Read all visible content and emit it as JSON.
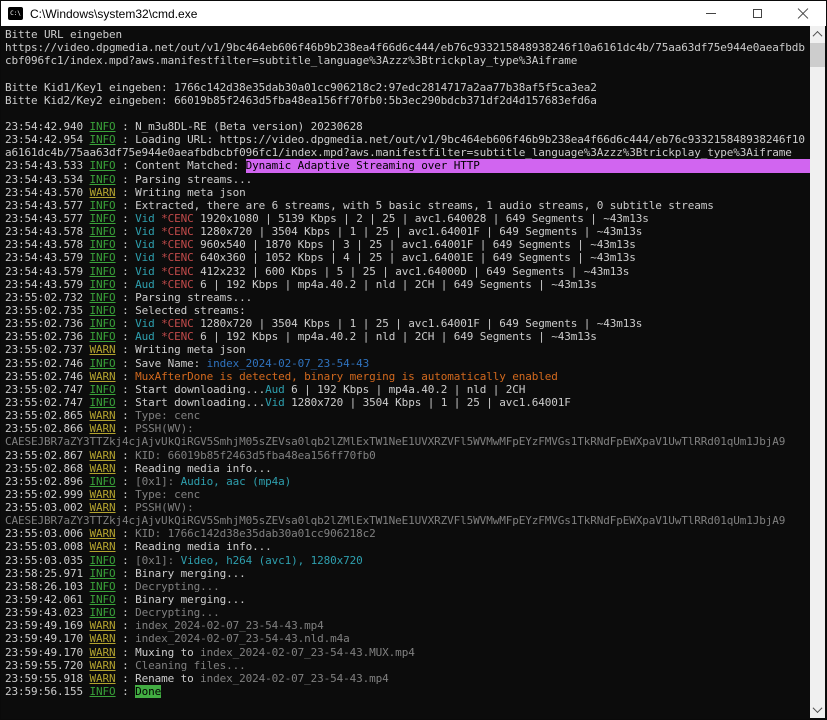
{
  "window": {
    "title": "C:\\Windows\\system32\\cmd.exe",
    "icon_text": "C:\\"
  },
  "colors": {
    "bg": "#0c0c0c",
    "fg": "#cccccc",
    "titlebar_bg": "#ffffff",
    "title_fg": "#000000",
    "info": "#39a239",
    "warn": "#b3a32e",
    "cyan": "#2e9fae",
    "red": "#c04a4a",
    "blue": "#2f72bd",
    "orange": "#d2691e",
    "gray": "#808080",
    "hl_magenta": "#d165f0",
    "hl_green": "#42ad42",
    "scroll_track": "#f0f0f0",
    "scroll_thumb": "#cdcdcd",
    "scroll_arrow": "#505050"
  },
  "terminal": {
    "lines": [
      [
        [
          "t",
          "Bitte URL eingeben"
        ]
      ],
      [
        [
          "t",
          "https://video.dpgmedia.net/out/v1/9bc464eb606f46b9b238ea4f66d6c444/eb76c933215848938246f10a6161dc4b/75aa63df75e944e0aeafbdb"
        ]
      ],
      [
        [
          "t",
          "cbf096fc1/index.mpd?aws.manifestfilter=subtitle_language%3Azzz%3Btrickplay_type%3Aiframe"
        ]
      ],
      [],
      [
        [
          "t",
          "Bitte Kid1/Key1 eingeben: 1766c142d38e35dab30a01cc906218c2:97edc2814717a2aa77b38af5f5ca3ea2"
        ]
      ],
      [
        [
          "t",
          "Bitte Kid2/Key2 eingeben: 66019b85f2463d5fba48ea156ff70fb0:5b3ec290bdcb371df2d4d157683efd6a"
        ]
      ],
      [],
      [
        [
          "t",
          "23:54:42.940 "
        ],
        [
          "info",
          "INFO"
        ],
        [
          "t",
          " : N_m3u8DL-RE (Beta version) 20230628"
        ]
      ],
      [
        [
          "t",
          "23:54:42.954 "
        ],
        [
          "info",
          "INFO"
        ],
        [
          "t",
          " : Loading URL: https://video.dpgmedia.net/out/v1/9bc464eb606f46b9b238ea4f66d6c444/eb76c933215848938246f10"
        ]
      ],
      [
        [
          "t",
          "a6161dc4b/75aa63df75e944e0aeafbdbcbf096fc1/index.mpd?aws.manifestfilter=subtitle_language%3Azzz%3Btrickplay_type%3Aiframe"
        ]
      ],
      [
        [
          "t",
          "23:54:43.533 "
        ],
        [
          "info",
          "INFO"
        ],
        [
          "t",
          " : Content Matched: "
        ],
        [
          "hlm",
          "Dynamic Adaptive Streaming over HTTP"
        ]
      ],
      [
        [
          "t",
          "23:54:43.534 "
        ],
        [
          "info",
          "INFO"
        ],
        [
          "t",
          " : Parsing streams..."
        ]
      ],
      [
        [
          "t",
          "23:54:43.570 "
        ],
        [
          "warn",
          "WARN"
        ],
        [
          "t",
          " : Writing meta json"
        ]
      ],
      [
        [
          "t",
          "23:54:43.577 "
        ],
        [
          "info",
          "INFO"
        ],
        [
          "t",
          " : Extracted, there are 6 streams, with 5 basic streams, 1 audio streams, 0 subtitle streams"
        ]
      ],
      [
        [
          "t",
          "23:54:43.577 "
        ],
        [
          "info",
          "INFO"
        ],
        [
          "t",
          " : "
        ],
        [
          "cyan",
          "Vid"
        ],
        [
          "t",
          " "
        ],
        [
          "red",
          "*CENC"
        ],
        [
          "t",
          " 1920x1080 | 5139 Kbps | 2 | 25 | avc1.640028 | 649 Segments | ~43m13s"
        ]
      ],
      [
        [
          "t",
          "23:54:43.578 "
        ],
        [
          "info",
          "INFO"
        ],
        [
          "t",
          " : "
        ],
        [
          "cyan",
          "Vid"
        ],
        [
          "t",
          " "
        ],
        [
          "red",
          "*CENC"
        ],
        [
          "t",
          " 1280x720 | 3504 Kbps | 1 | 25 | avc1.64001F | 649 Segments | ~43m13s"
        ]
      ],
      [
        [
          "t",
          "23:54:43.578 "
        ],
        [
          "info",
          "INFO"
        ],
        [
          "t",
          " : "
        ],
        [
          "cyan",
          "Vid"
        ],
        [
          "t",
          " "
        ],
        [
          "red",
          "*CENC"
        ],
        [
          "t",
          " 960x540 | 1870 Kbps | 3 | 25 | avc1.64001F | 649 Segments | ~43m13s"
        ]
      ],
      [
        [
          "t",
          "23:54:43.579 "
        ],
        [
          "info",
          "INFO"
        ],
        [
          "t",
          " : "
        ],
        [
          "cyan",
          "Vid"
        ],
        [
          "t",
          " "
        ],
        [
          "red",
          "*CENC"
        ],
        [
          "t",
          " 640x360 | 1052 Kbps | 4 | 25 | avc1.64001E | 649 Segments | ~43m13s"
        ]
      ],
      [
        [
          "t",
          "23:54:43.579 "
        ],
        [
          "info",
          "INFO"
        ],
        [
          "t",
          " : "
        ],
        [
          "cyan",
          "Vid"
        ],
        [
          "t",
          " "
        ],
        [
          "red",
          "*CENC"
        ],
        [
          "t",
          " 412x232 | 600 Kbps | 5 | 25 | avc1.64000D | 649 Segments | ~43m13s"
        ]
      ],
      [
        [
          "t",
          "23:54:43.579 "
        ],
        [
          "info",
          "INFO"
        ],
        [
          "t",
          " : "
        ],
        [
          "cyan",
          "Aud"
        ],
        [
          "t",
          " "
        ],
        [
          "red",
          "*CENC"
        ],
        [
          "t",
          " 6 | 192 Kbps | mp4a.40.2 | nld | 2CH | 649 Segments | ~43m13s"
        ]
      ],
      [
        [
          "t",
          "23:55:02.732 "
        ],
        [
          "info",
          "INFO"
        ],
        [
          "t",
          " : Parsing streams..."
        ]
      ],
      [
        [
          "t",
          "23:55:02.735 "
        ],
        [
          "info",
          "INFO"
        ],
        [
          "t",
          " : Selected streams:"
        ]
      ],
      [
        [
          "t",
          "23:55:02.736 "
        ],
        [
          "info",
          "INFO"
        ],
        [
          "t",
          " : "
        ],
        [
          "cyan",
          "Vid"
        ],
        [
          "t",
          " "
        ],
        [
          "red",
          "*CENC"
        ],
        [
          "t",
          " 1280x720 | 3504 Kbps | 1 | 25 | avc1.64001F | 649 Segments | ~43m13s"
        ]
      ],
      [
        [
          "t",
          "23:55:02.736 "
        ],
        [
          "info",
          "INFO"
        ],
        [
          "t",
          " : "
        ],
        [
          "cyan",
          "Aud"
        ],
        [
          "t",
          " "
        ],
        [
          "red",
          "*CENC"
        ],
        [
          "t",
          " 6 | 192 Kbps | mp4a.40.2 | nld | 2CH | 649 Segments | ~43m13s"
        ]
      ],
      [
        [
          "t",
          "23:55:02.737 "
        ],
        [
          "warn",
          "WARN"
        ],
        [
          "t",
          " : Writing meta json"
        ]
      ],
      [
        [
          "t",
          "23:55:02.746 "
        ],
        [
          "info",
          "INFO"
        ],
        [
          "t",
          " : Save Name: "
        ],
        [
          "blue",
          "index_2024-02-07_23-54-43"
        ]
      ],
      [
        [
          "t",
          "23:55:02.746 "
        ],
        [
          "warn",
          "WARN"
        ],
        [
          "t",
          " : "
        ],
        [
          "orange",
          "MuxAfterDone is detected, binary merging is automatically enabled"
        ]
      ],
      [
        [
          "t",
          "23:55:02.747 "
        ],
        [
          "info",
          "INFO"
        ],
        [
          "t",
          " : Start downloading..."
        ],
        [
          "cyan",
          "Aud"
        ],
        [
          "t",
          " 6 | 192 Kbps | mp4a.40.2 | nld | 2CH"
        ]
      ],
      [
        [
          "t",
          "23:55:02.747 "
        ],
        [
          "info",
          "INFO"
        ],
        [
          "t",
          " : Start downloading..."
        ],
        [
          "cyan",
          "Vid"
        ],
        [
          "t",
          " 1280x720 | 3504 Kbps | 1 | 25 | avc1.64001F"
        ]
      ],
      [
        [
          "t",
          "23:55:02.865 "
        ],
        [
          "warn",
          "WARN"
        ],
        [
          "t",
          " : "
        ],
        [
          "gray",
          "Type: cenc"
        ]
      ],
      [
        [
          "t",
          "23:55:02.866 "
        ],
        [
          "warn",
          "WARN"
        ],
        [
          "t",
          " : "
        ],
        [
          "gray",
          "PSSH(WV):"
        ]
      ],
      [
        [
          "gray",
          "CAESEJBR7aZY3TTZkj4cjAjvUkQiRGV5SmhjM05sZEVsa0lqb2lZMlExTW1NeE1UVXRZVFl5WVMwMFpEYzFMVGs1TkRNdFpEWXpaV1UwTlRRd01qUm1JbjA9"
        ]
      ],
      [
        [
          "t",
          "23:55:02.867 "
        ],
        [
          "warn",
          "WARN"
        ],
        [
          "t",
          " : "
        ],
        [
          "gray",
          "KID: 66019b85f2463d5fba48ea156ff70fb0"
        ]
      ],
      [
        [
          "t",
          "23:55:02.868 "
        ],
        [
          "warn",
          "WARN"
        ],
        [
          "t",
          " : Reading media info..."
        ]
      ],
      [
        [
          "t",
          "23:55:02.896 "
        ],
        [
          "info",
          "INFO"
        ],
        [
          "t",
          " : "
        ],
        [
          "gray",
          "[0x1]: "
        ],
        [
          "cyan",
          "Audio, aac (mp4a)"
        ]
      ],
      [
        [
          "t",
          "23:55:02.999 "
        ],
        [
          "warn",
          "WARN"
        ],
        [
          "t",
          " : "
        ],
        [
          "gray",
          "Type: cenc"
        ]
      ],
      [
        [
          "t",
          "23:55:03.002 "
        ],
        [
          "warn",
          "WARN"
        ],
        [
          "t",
          " : "
        ],
        [
          "gray",
          "PSSH(WV):"
        ]
      ],
      [
        [
          "gray",
          "CAESEJBR7aZY3TTZkj4cjAjvUkQiRGV5SmhjM05sZEVsa0lqb2lZMlExTW1NeE1UVXRZVFl5WVMwMFpEYzFMVGs1TkRNdFpEWXpaV1UwTlRRd01qUm1JbjA9"
        ]
      ],
      [
        [
          "t",
          "23:55:03.006 "
        ],
        [
          "warn",
          "WARN"
        ],
        [
          "t",
          " : "
        ],
        [
          "gray",
          "KID: 1766c142d38e35dab30a01cc906218c2"
        ]
      ],
      [
        [
          "t",
          "23:55:03.008 "
        ],
        [
          "warn",
          "WARN"
        ],
        [
          "t",
          " : Reading media info..."
        ]
      ],
      [
        [
          "t",
          "23:55:03.035 "
        ],
        [
          "info",
          "INFO"
        ],
        [
          "t",
          " : "
        ],
        [
          "gray",
          "[0x1]: "
        ],
        [
          "cyan",
          "Video, h264 (avc1), 1280x720"
        ]
      ],
      [
        [
          "t",
          "23:58:25.971 "
        ],
        [
          "info",
          "INFO"
        ],
        [
          "t",
          " : Binary merging..."
        ]
      ],
      [
        [
          "t",
          "23:58:26.103 "
        ],
        [
          "info",
          "INFO"
        ],
        [
          "t",
          " : "
        ],
        [
          "gray",
          "Decrypting..."
        ]
      ],
      [
        [
          "t",
          "23:59:42.061 "
        ],
        [
          "info",
          "INFO"
        ],
        [
          "t",
          " : Binary merging..."
        ]
      ],
      [
        [
          "t",
          "23:59:43.023 "
        ],
        [
          "info",
          "INFO"
        ],
        [
          "t",
          " : "
        ],
        [
          "gray",
          "Decrypting..."
        ]
      ],
      [
        [
          "t",
          "23:59:49.169 "
        ],
        [
          "warn",
          "WARN"
        ],
        [
          "t",
          " : "
        ],
        [
          "gray",
          "index_2024-02-07_23-54-43.mp4"
        ]
      ],
      [
        [
          "t",
          "23:59:49.170 "
        ],
        [
          "warn",
          "WARN"
        ],
        [
          "t",
          " : "
        ],
        [
          "gray",
          "index_2024-02-07_23-54-43.nld.m4a"
        ]
      ],
      [
        [
          "t",
          "23:59:49.170 "
        ],
        [
          "warn",
          "WARN"
        ],
        [
          "t",
          " : Muxing to "
        ],
        [
          "gray",
          "index_2024-02-07_23-54-43.MUX.mp4"
        ]
      ],
      [
        [
          "t",
          "23:59:55.720 "
        ],
        [
          "warn",
          "WARN"
        ],
        [
          "t",
          " : "
        ],
        [
          "gray",
          "Cleaning files..."
        ]
      ],
      [
        [
          "t",
          "23:59:55.918 "
        ],
        [
          "warn",
          "WARN"
        ],
        [
          "t",
          " : Rename to "
        ],
        [
          "gray",
          "index_2024-02-07_23-54-43.mp4"
        ]
      ],
      [
        [
          "t",
          "23:59:56.155 "
        ],
        [
          "info",
          "INFO"
        ],
        [
          "t",
          " : "
        ],
        [
          "hlg",
          "Done"
        ]
      ]
    ]
  }
}
